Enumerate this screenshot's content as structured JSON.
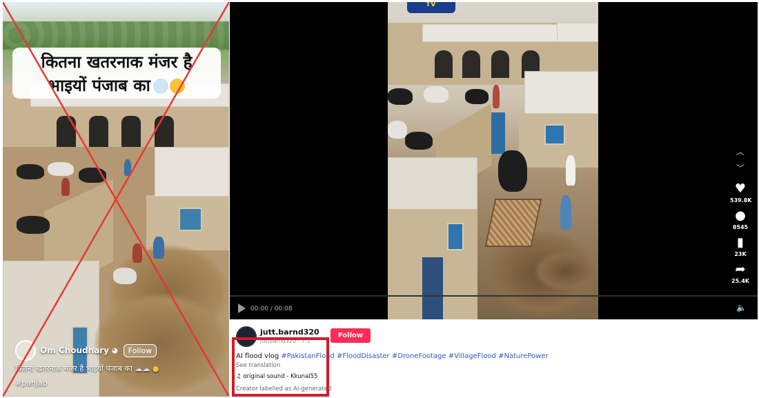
{
  "left_post": {
    "overlay_text_line1": "कितना खतरनाक मंजर है",
    "overlay_text_line2": "भाइयों पंजाब का",
    "username": "Om Choudhary",
    "verified_icon": "◕",
    "follow_label": "Follow",
    "caption": "कितना खतरनाक मंजर है भाइयों पंजाब का",
    "hashtag": "#panjab",
    "cross_color": "#e53935"
  },
  "video": {
    "channel_logo_text": "TV",
    "time": "00:00 / 00:08",
    "volume_icon": "🔈",
    "nav_up_icon": "chevron-up-icon",
    "nav_down_icon": "chevron-down-icon",
    "actions": [
      {
        "icon": "heart-icon",
        "glyph": "♥",
        "count": "539.8K"
      },
      {
        "icon": "comment-icon",
        "glyph": "●",
        "count": "8545"
      },
      {
        "icon": "bookmark-icon",
        "glyph": "▮",
        "count": "23K"
      },
      {
        "icon": "share-icon",
        "glyph": "➦",
        "count": "25.4K"
      }
    ]
  },
  "post_info": {
    "username": "jutt.barnd320",
    "username_sub": "juttbarnd320 · 7-1",
    "follow_label": "Follow",
    "description_text": "AI flood vlog",
    "hashtags": [
      "#PakistanFlood",
      "#FloodDisaster",
      "#DroneFootage",
      "#VillageFlood",
      "#NaturePower"
    ],
    "see_translation": "See translation",
    "sound": "♫ original sound - Kkunal55",
    "ai_label": "Creator labelled as AI-generated",
    "highlight_color": "#d31a2a",
    "follow_color": "#fe2c55"
  }
}
